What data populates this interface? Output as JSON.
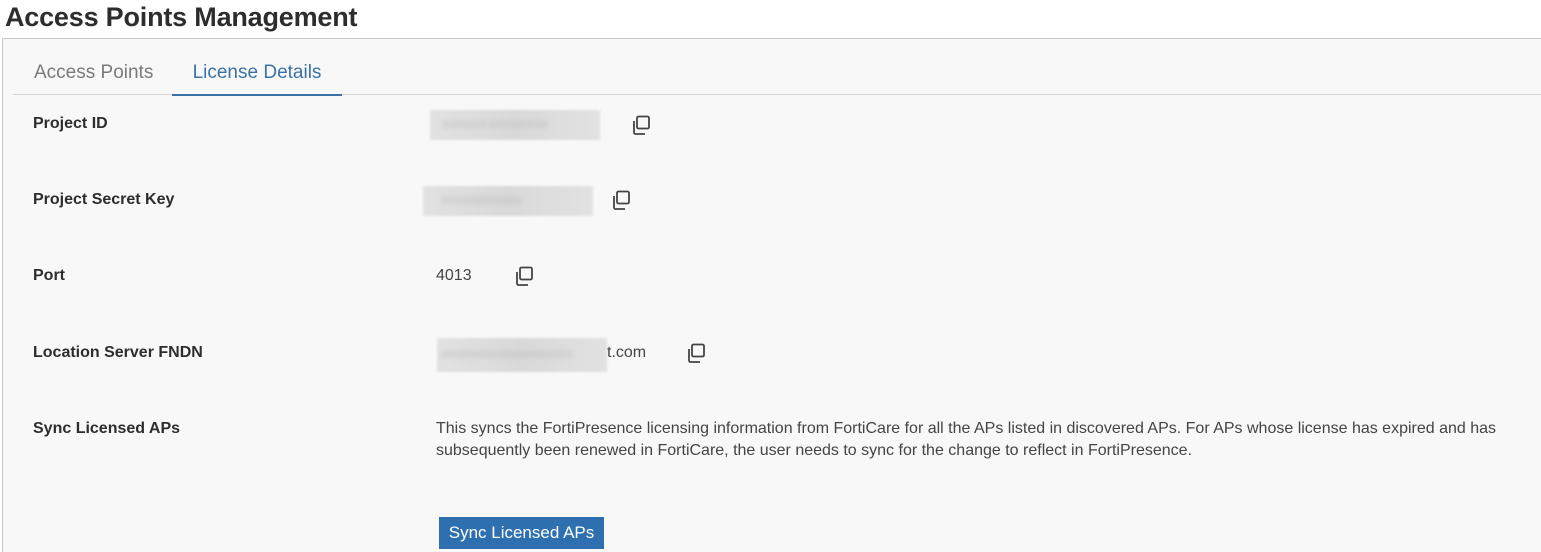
{
  "page": {
    "title": "Access Points Management"
  },
  "tabs": [
    {
      "label": "Access Points",
      "active": false
    },
    {
      "label": "License Details",
      "active": true
    }
  ],
  "fields": {
    "project_id": {
      "label": "Project ID",
      "value": "(redacted)"
    },
    "project_secret_key": {
      "label": "Project Secret Key",
      "value": "(redacted)"
    },
    "port": {
      "label": "Port",
      "value": "4013"
    },
    "location_server_fqdn": {
      "label": "Location Server FNDN",
      "value_suffix": "t.com"
    },
    "sync_licensed_aps": {
      "label": "Sync Licensed APs",
      "description": "This syncs the FortiPresence licensing information from FortiCare for all the APs listed in discovered APs. For APs whose license has expired and has subsequently been renewed in FortiCare, the user needs to sync for the change to reflect in FortiPresence.",
      "button_label": "Sync Licensed APs"
    }
  },
  "colors": {
    "accent": "#3a72a8",
    "button": "#2e6fb0",
    "panel_bg": "#f8f8f8"
  },
  "icons": {
    "copy": "copy-icon"
  }
}
